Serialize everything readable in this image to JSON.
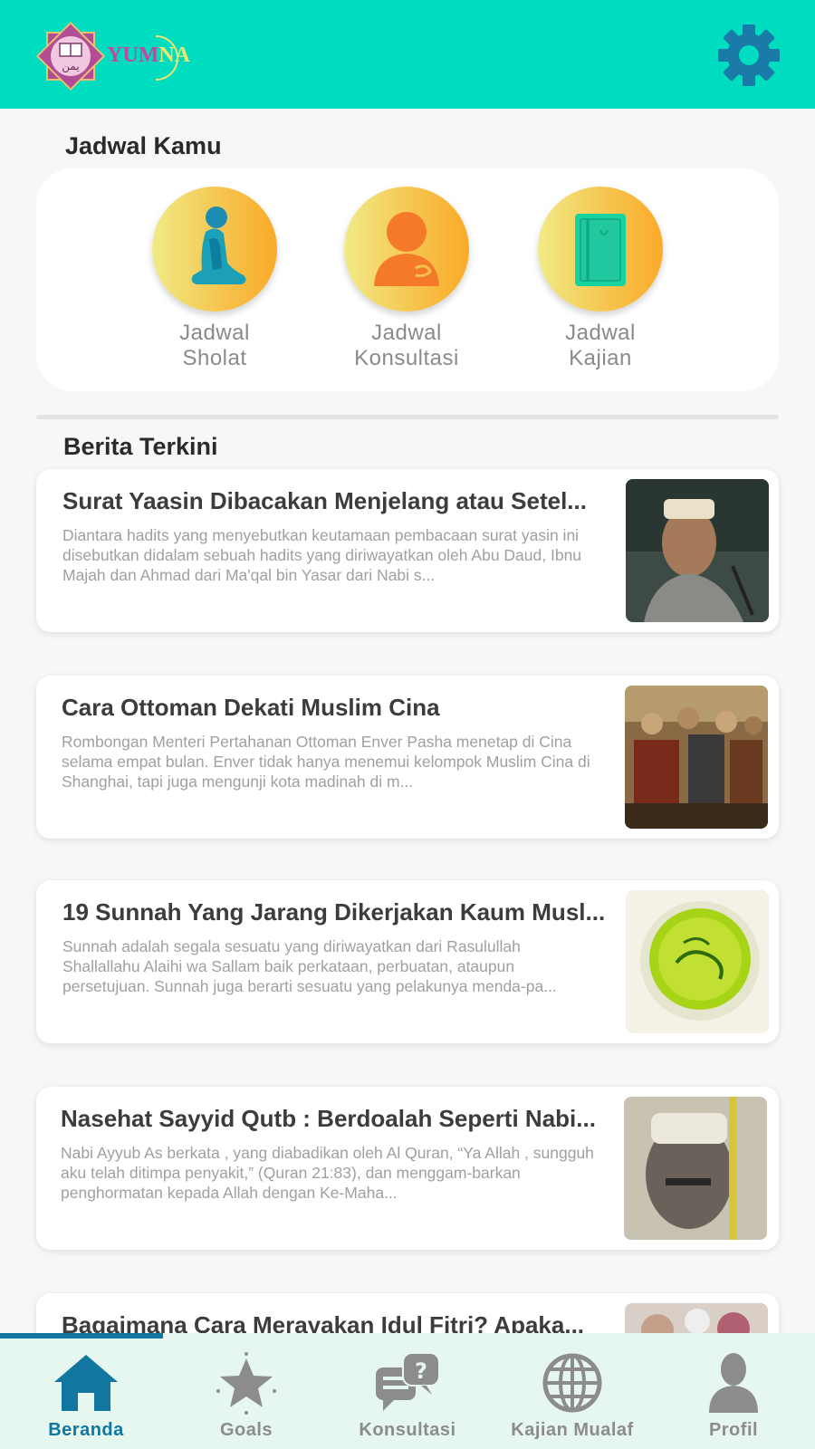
{
  "header": {
    "logo_text_main": "YUM",
    "logo_text_accent": "NA",
    "logo_arabic": "يمن"
  },
  "schedule": {
    "title": "Jadwal Kamu",
    "items": [
      {
        "label": "Jadwal\nSholat",
        "icon": "praying-person-icon"
      },
      {
        "label": "Jadwal\nKonsultasi",
        "icon": "person-icon"
      },
      {
        "label": "Jadwal\nKajian",
        "icon": "book-icon"
      }
    ]
  },
  "news": {
    "title": "Berita Terkini",
    "items": [
      {
        "title": "Surat Yaasin Dibacakan Menjelang atau Setel...",
        "body": "Diantara hadits yang menyebutkan keutamaan pembacaan surat yasin ini disebutkan didalam sebuah hadits yang diriwayatkan oleh Abu Daud, Ibnu Majah dan Ahmad dari Ma'qal bin Yasar dari Nabi s..."
      },
      {
        "title": "Cara Ottoman Dekati Muslim Cina",
        "body": "Rombongan Menteri Pertahanan Ottoman Enver Pasha menetap di Cina selama empat bulan. Enver tidak hanya menemui kelompok Muslim Cina di Shanghai, tapi juga mengunji kota madinah di m..."
      },
      {
        "title": "19 Sunnah Yang Jarang Dikerjakan Kaum Musl...",
        "body": "Sunnah adalah segala sesuatu yang diriwayatkan dari Rasulullah Shallallahu Alaihi wa Sallam baik perkataan, perbuatan, ataupun persetujuan. Sunnah juga berarti sesuatu yang pelakunya menda-pa..."
      },
      {
        "title": "Nasehat Sayyid Qutb : Berdoalah Seperti Nabi...",
        "body": "Nabi Ayyub As  berkata , yang diabadikan oleh Al Quran, “Ya Allah , sungguh aku telah ditimpa penyakit,” (Quran 21:83), dan menggam-barkan penghormatan kepada Allah dengan Ke-Maha..."
      },
      {
        "title": "Bagaimana Cara Merayakan Idul Fitri? Apaka...",
        "body": ""
      }
    ]
  },
  "nav": {
    "items": [
      {
        "label": "Beranda",
        "icon": "home-icon",
        "active": true
      },
      {
        "label": "Goals",
        "icon": "star-icon",
        "active": false
      },
      {
        "label": "Konsultasi",
        "icon": "chat-question-icon",
        "active": false
      },
      {
        "label": "Kajian Mualaf",
        "icon": "globe-icon",
        "active": false
      },
      {
        "label": "Profil",
        "icon": "user-icon",
        "active": false
      }
    ]
  },
  "colors": {
    "header_bg": "#00dcc0",
    "accent": "#1177a0",
    "nav_bg": "#e6f7f0"
  }
}
